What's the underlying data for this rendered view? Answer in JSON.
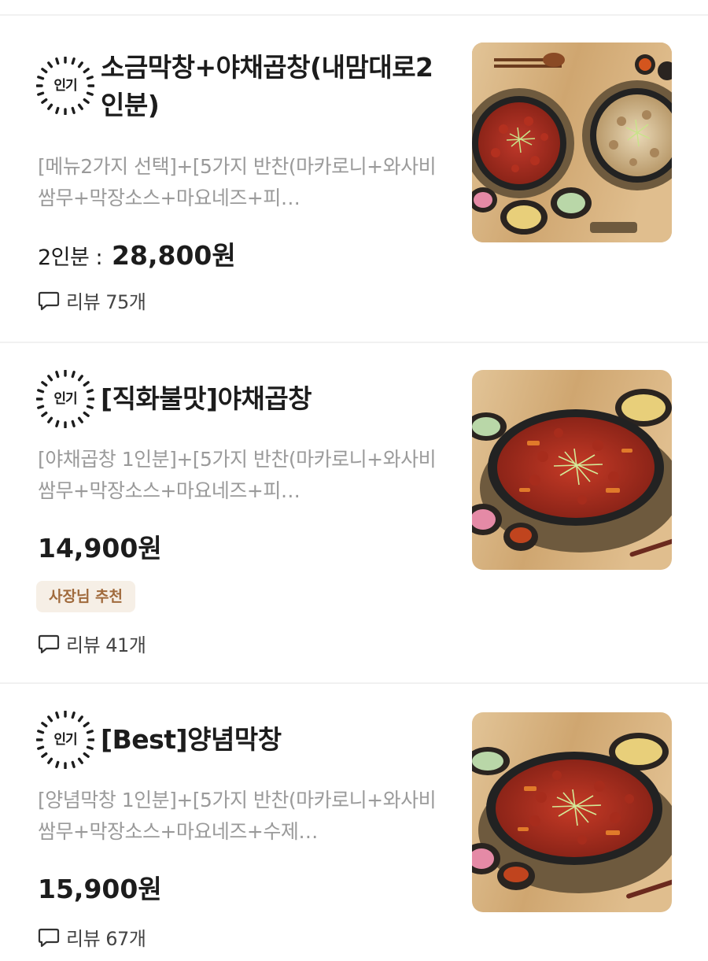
{
  "items": [
    {
      "badge": "인기",
      "title": "소금막창+야채곱창(내맘대로2인분)",
      "description": "[메뉴2가지 선택]+[5가지 반찬(마카로니+와사비쌈무+막장소스+마요네즈+피…",
      "price_label": "2인분 :",
      "price": "28,800원",
      "tag": "",
      "review": "리뷰 75개",
      "image_icon": "two-pan-dish-image"
    },
    {
      "badge": "인기",
      "title": "[직화불맛]야채곱창",
      "description": "[야채곱창 1인분]+[5가지 반찬(마카로니+와사비쌈무+막장소스+마요네즈+피…",
      "price_label": "",
      "price": "14,900원",
      "tag": "사장님 추천",
      "review": "리뷰 41개",
      "image_icon": "pan-dish-image"
    },
    {
      "badge": "인기",
      "title": "[Best]양념막창",
      "description": "[양념막창 1인분]+[5가지 반찬(마카로니+와사비쌈무+막장소스+마요네즈+수제…",
      "price_label": "",
      "price": "15,900원",
      "tag": "",
      "review": "리뷰 67개",
      "image_icon": "pan-dish-image"
    }
  ],
  "colors": {
    "text": "#1c1c1c",
    "muted": "#9a9a9a",
    "tag_bg": "#f6efe6",
    "tag_text": "#a06a3c",
    "divider": "#f1f1f1"
  }
}
